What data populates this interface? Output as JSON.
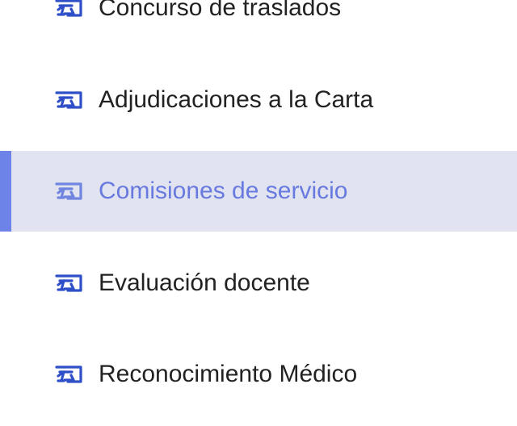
{
  "menu": {
    "active_index": 2,
    "colors": {
      "icon": "#2f4fc8",
      "active_accent": "#6d83e8",
      "active_background": "#e1e4f0",
      "active_text": "#6879df",
      "text": "#222222"
    },
    "items": [
      {
        "label": "Concurso de traslados",
        "icon": "transfer-document-icon"
      },
      {
        "label": "Adjudicaciones a la Carta",
        "icon": "transfer-document-icon"
      },
      {
        "label": "Comisiones de servicio",
        "icon": "transfer-document-icon"
      },
      {
        "label": "Evaluación docente",
        "icon": "transfer-document-icon"
      },
      {
        "label": "Reconocimiento Médico",
        "icon": "transfer-document-icon"
      }
    ]
  }
}
